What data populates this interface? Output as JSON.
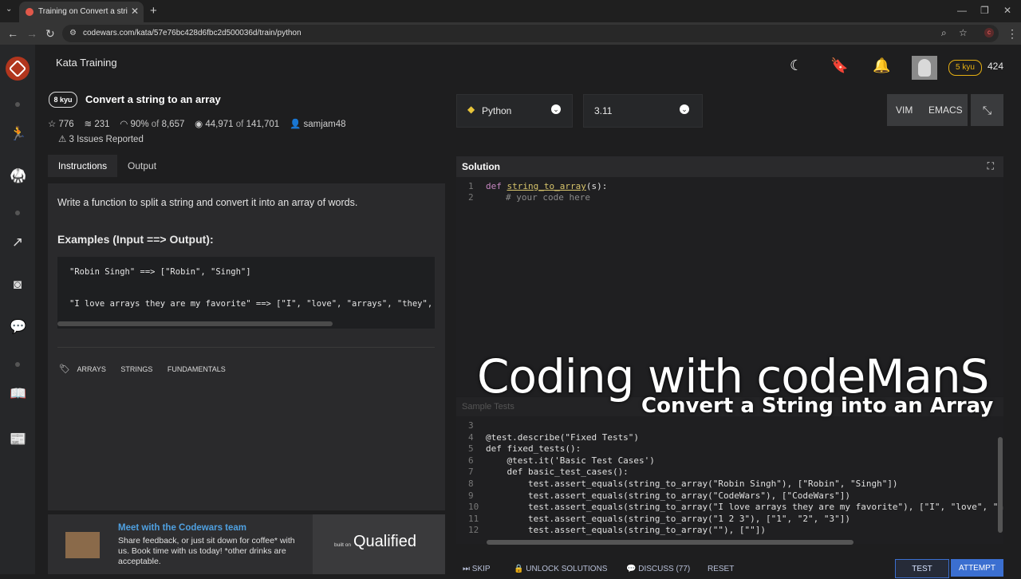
{
  "browser": {
    "tab_title": "Training on Convert a string to a",
    "url": "codewars.com/kata/57e76bc428d6fbc2d500036d/train/python",
    "new_tab": "+",
    "close": "✕"
  },
  "header": {
    "title": "Kata Training",
    "rank_badge": "5 kyu",
    "honor": "424"
  },
  "kata": {
    "kyu": "8 kyu",
    "title": "Convert a string to an array",
    "stars": "776",
    "collections": "231",
    "satisfaction": "90%",
    "satisfaction_of": "of",
    "votes": "8,657",
    "completed": "44,971",
    "completed_of": "of",
    "attempts": "141,701",
    "author": "samjam48",
    "issues": "3 Issues Reported"
  },
  "left_tabs": {
    "instructions": "Instructions",
    "output": "Output"
  },
  "description": {
    "text": "Write a function to split a string and convert it into an array of words.",
    "heading": "Examples (Input ==> Output):",
    "example1": "\"Robin Singh\" ==> [\"Robin\", \"Singh\"]",
    "example2": "\"I love arrays they are my favorite\" ==> [\"I\", \"love\", \"arrays\", \"they\",",
    "tags": [
      "ARRAYS",
      "STRINGS",
      "FUNDAMENTALS"
    ]
  },
  "promo": {
    "title": "Meet with the Codewars team",
    "body": "Share feedback, or just sit down for coffee* with us. Book time with us today! *other drinks are acceptable.",
    "built_on": "built on",
    "brand": "Qualified"
  },
  "editor": {
    "language": "Python",
    "version": "3.11",
    "vim": "VIM",
    "emacs": "EMACS",
    "solution_label": "Solution",
    "solution_lines": [
      {
        "n": "1",
        "kw": "def",
        "fn": "string_to_array",
        "rest": "(s):"
      },
      {
        "n": "2",
        "comment": "# your code here"
      }
    ],
    "sample_tests_label": "Sample Tests",
    "test_lines": [
      {
        "n": "3",
        "code": ""
      },
      {
        "n": "4",
        "code": "@test.describe(\"Fixed Tests\")"
      },
      {
        "n": "5",
        "code": "def fixed_tests():"
      },
      {
        "n": "6",
        "code": "    @test.it('Basic Test Cases')"
      },
      {
        "n": "7",
        "code": "    def basic_test_cases():"
      },
      {
        "n": "8",
        "code": "        test.assert_equals(string_to_array(\"Robin Singh\"), [\"Robin\", \"Singh\"])"
      },
      {
        "n": "9",
        "code": "        test.assert_equals(string_to_array(\"CodeWars\"), [\"CodeWars\"])"
      },
      {
        "n": "10",
        "code": "        test.assert_equals(string_to_array(\"I love arrays they are my favorite\"), [\"I\", \"love\", \"arr"
      },
      {
        "n": "11",
        "code": "        test.assert_equals(string_to_array(\"1 2 3\"), [\"1\", \"2\", \"3\"])"
      },
      {
        "n": "12",
        "code": "        test.assert_equals(string_to_array(\"\"), [\"\"])"
      }
    ]
  },
  "actions": {
    "skip": "SKIP",
    "unlock": "UNLOCK SOLUTIONS",
    "discuss": "DISCUSS (77)",
    "reset": "RESET",
    "test": "TEST",
    "attempt": "ATTEMPT"
  },
  "overlay": {
    "line1": "Coding with codeManS",
    "line2": "Convert a String into an Array"
  },
  "colors": {
    "brand_red": "#b1361e",
    "rank_yellow": "#e6b012",
    "link_blue": "#4fa0e0",
    "attempt_blue": "#3b6fd0"
  }
}
